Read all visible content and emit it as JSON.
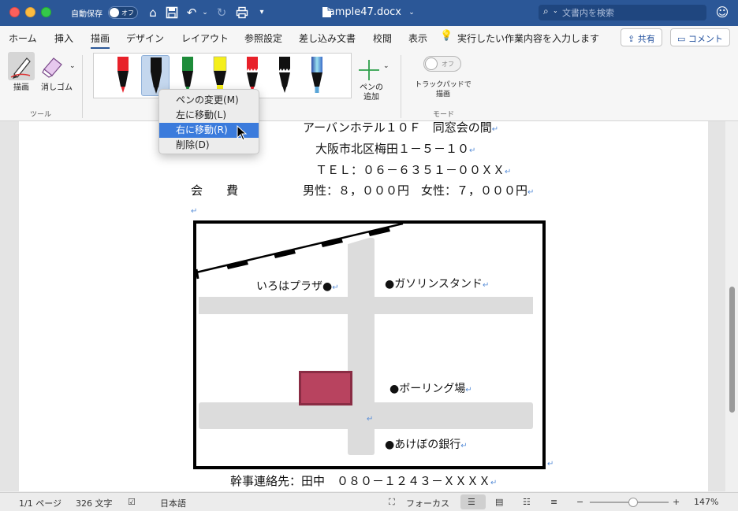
{
  "titlebar": {
    "autosave_label": "自動保存",
    "autosave_state": "オフ",
    "doc_title": "sample47.docx",
    "search_placeholder": "文書内を検索"
  },
  "tabs": [
    "ホーム",
    "挿入",
    "描画",
    "デザイン",
    "レイアウト",
    "参照設定",
    "差し込み文書",
    "校閲",
    "表示"
  ],
  "active_tab": "描画",
  "tell_me": "実行したい作業内容を入力します",
  "share_label": "共有",
  "comment_label": "コメント",
  "ribbon": {
    "draw_label": "描画",
    "eraser_label": "消しゴム",
    "tools_group": "ツール",
    "add_pen_label_1": "ペンの",
    "add_pen_label_2": "追加",
    "trackpad_toggle": "オフ",
    "trackpad_label_1": "トラックパッドで",
    "trackpad_label_2": "描画",
    "mode_group": "モード",
    "pens": [
      {
        "color": "#e8212a",
        "type": "pen"
      },
      {
        "color": "#111111",
        "type": "pen",
        "selected": true
      },
      {
        "color": "#1e8c3a",
        "type": "pen"
      },
      {
        "color": "#f5ef1a",
        "type": "highlighter"
      },
      {
        "color": "#e8212a",
        "type": "pencil"
      },
      {
        "color": "#111111",
        "type": "pencil"
      },
      {
        "color": "#5aa6d8",
        "type": "galaxy"
      }
    ]
  },
  "context_menu": {
    "items": [
      "ペンの変更(M)",
      "左に移動(L)",
      "右に移動(R)",
      "削除(D)"
    ],
    "highlighted": "右に移動(R)"
  },
  "document": {
    "line1": "アーバンホテル１０Ｆ　同窓会の間",
    "line2": "大阪市北区梅田１－５－１０",
    "line3": "ＴＥＬ：０６－６３５１－００ＸＸ",
    "fee_label": "会　　費",
    "fee_value": "男性：８，０００円　女性：７，０００円",
    "contact": "幹事連絡先：田中　０８０－１２４３－ＸＸＸＸ",
    "map": {
      "label_plaza": "いろはプラザ●",
      "label_gas": "●ガソリンスタンド",
      "label_bowling": "●ボーリング場",
      "label_bank": "●あけぼの銀行",
      "building_color": "#b8435f"
    }
  },
  "statusbar": {
    "page": "1/1 ページ",
    "words": "326 文字",
    "language": "日本語",
    "focus": "フォーカス",
    "zoom": "147%",
    "zoom_level": 0.55
  },
  "colors": {
    "titlebar": "#2b5797",
    "highlight": "#3b7bdc"
  }
}
